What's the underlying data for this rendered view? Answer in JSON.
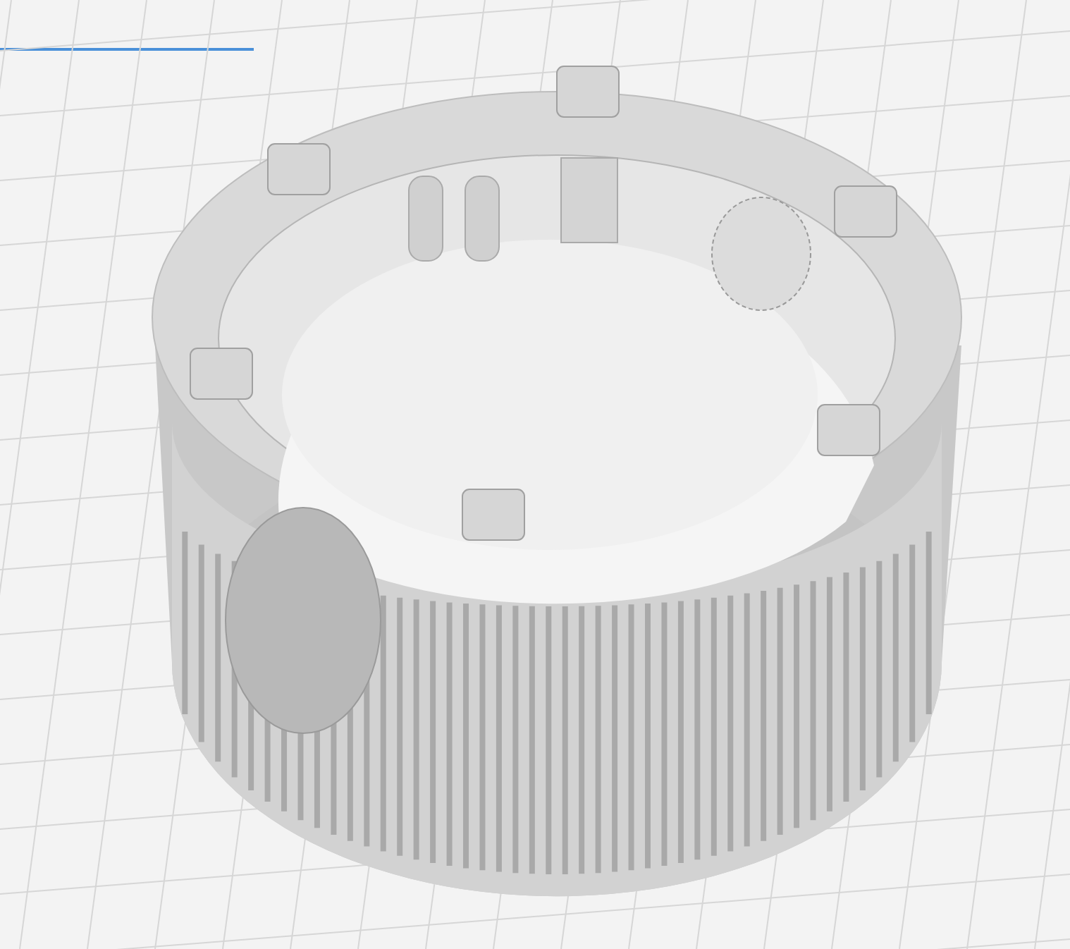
{
  "viewport": {
    "grid_visible": true,
    "model_visible": true
  }
}
